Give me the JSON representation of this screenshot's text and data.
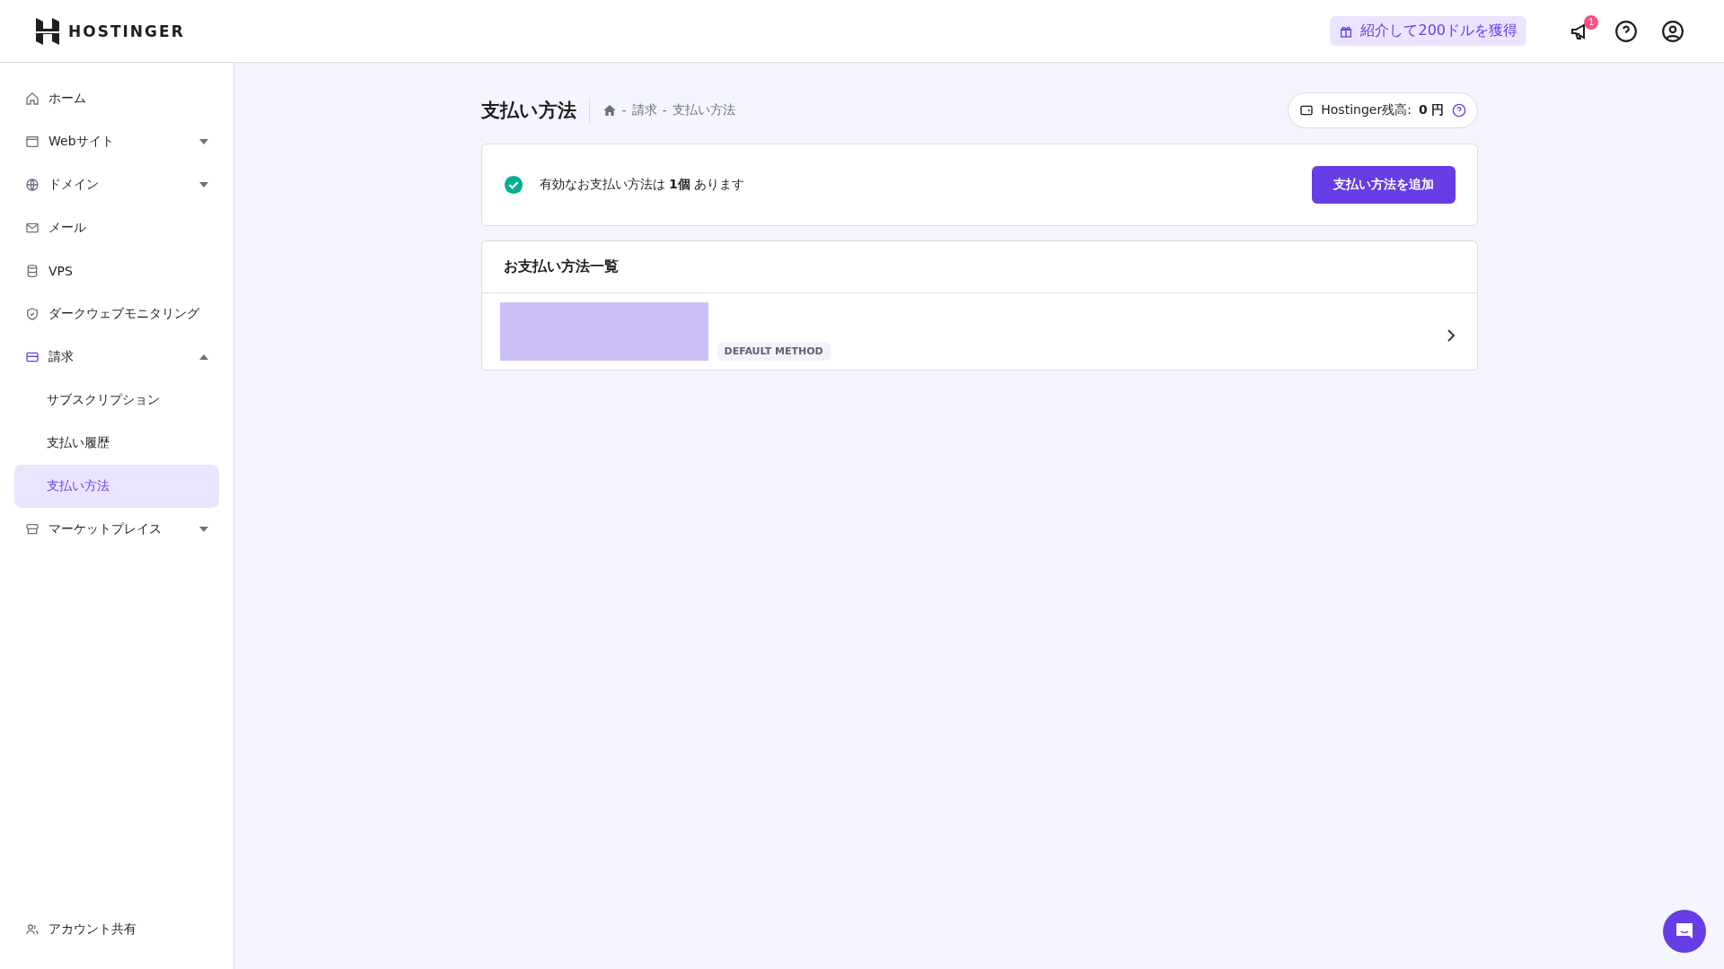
{
  "header": {
    "logo": "HOSTINGER",
    "referral": "紹介して200ドルを獲得",
    "notification_count": "1"
  },
  "sidebar": {
    "items": [
      {
        "label": "ホーム",
        "expandable": false,
        "selected": false
      },
      {
        "label": "Webサイト",
        "expandable": true,
        "expanded": false,
        "selected": false
      },
      {
        "label": "ドメイン",
        "expandable": true,
        "expanded": false,
        "selected": false
      },
      {
        "label": "メール",
        "expandable": false,
        "selected": false
      },
      {
        "label": "VPS",
        "expandable": false,
        "selected": false
      },
      {
        "label": "ダークウェブモニタリング",
        "expandable": false,
        "selected": false
      },
      {
        "label": "請求",
        "expandable": true,
        "expanded": true,
        "selected": false,
        "children": [
          {
            "label": "サブスクリプション",
            "selected": false
          },
          {
            "label": "支払い履歴",
            "selected": false
          },
          {
            "label": "支払い方法",
            "selected": true
          }
        ]
      },
      {
        "label": "マーケットプレイス",
        "expandable": true,
        "expanded": false,
        "selected": false
      }
    ],
    "footer_item": "アカウント共有"
  },
  "page": {
    "title": "支払い方法",
    "breadcrumb": [
      "請求",
      "支払い方法"
    ],
    "breadcrumb_separator": "-",
    "balance_label": "Hostinger残高:",
    "balance_value": "0 円",
    "status_message": "有効なお支払い方法は **1個** あります",
    "add_button": "支払い方法を追加",
    "list_title": "お支払い方法一覧",
    "methods": [
      {
        "badge": "DEFAULT METHOD"
      }
    ]
  }
}
